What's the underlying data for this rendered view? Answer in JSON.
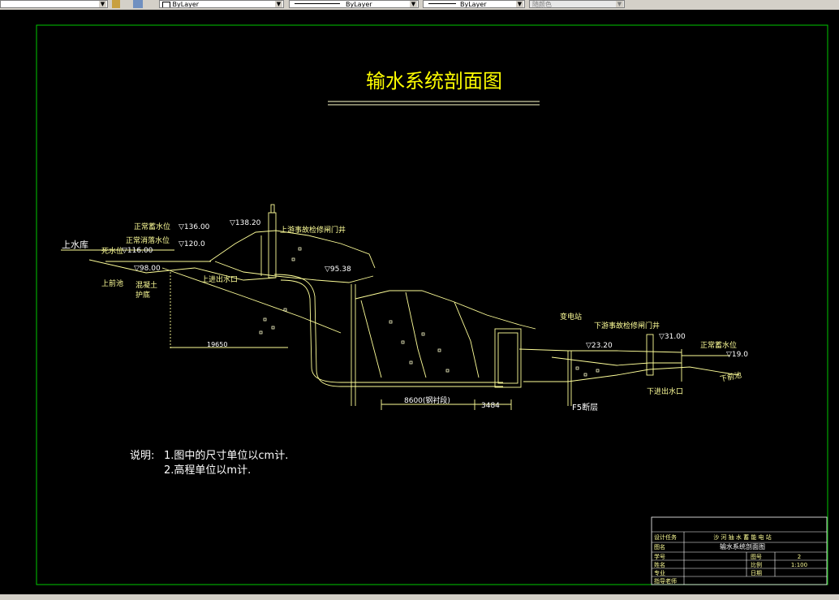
{
  "toolbar": {
    "layer_color_1": "ByLayer",
    "layer_linetype": "ByLayer",
    "layer_lineweight": "ByLayer",
    "plot_style": "随颜色"
  },
  "colors": {
    "background": "#000000",
    "linework": "#ffff99",
    "frame": "#00c800",
    "title": "#ffff00",
    "text": "#ffffff"
  },
  "drawing": {
    "title": "输水系统剖面图",
    "labels": {
      "upper_reservoir": "上水库",
      "normal_water_level": "正常蓄水位",
      "level_136": "▽136.00",
      "normal_flood_level": "正常消落水位",
      "level_120": "▽120.0",
      "dead_water_level": "死水位",
      "level_116": "▽116.00",
      "level_98": "▽98.00",
      "upper_pool": "上前池",
      "concrete": "混凝土",
      "protection": "护底",
      "level_138": "▽138.20",
      "upper_gate_shaft": "上游事故检修闸门井",
      "level_95": "▽95.38",
      "upper_inlet": "上进出水口",
      "dim_19650": "19650",
      "dim_8600": "8600(钢衬段)",
      "dim_3484": "3484",
      "substation": "变电站",
      "lower_gate_shaft": "下游事故检修闸门井",
      "level_23": "▽23.20",
      "level_31": "▽31.00",
      "lower_normal_level": "正常蓄水位",
      "level_19": "▽19.0",
      "lower_pool": "下前池",
      "lower_inlet": "下进出水口",
      "fault": "F5断层"
    },
    "notes": {
      "heading": "说明:",
      "line1": "1.图中的尺寸单位以cm计.",
      "line2": "2.高程单位以m计."
    },
    "title_block": {
      "r1_label": "设计任务",
      "r1_value": "沙 河 抽 水 蓄 能 电 站",
      "r2_label": "图名",
      "r2_value": "输水系统剖面图",
      "r3_label": "学号",
      "r3_mid": "图号",
      "r3_value": "2",
      "r4_label": "姓名",
      "r4_mid": "比例",
      "r4_value": "1:100",
      "r5_label": "专业",
      "r5_mid": "日期",
      "r6_label": "指导老师"
    }
  }
}
